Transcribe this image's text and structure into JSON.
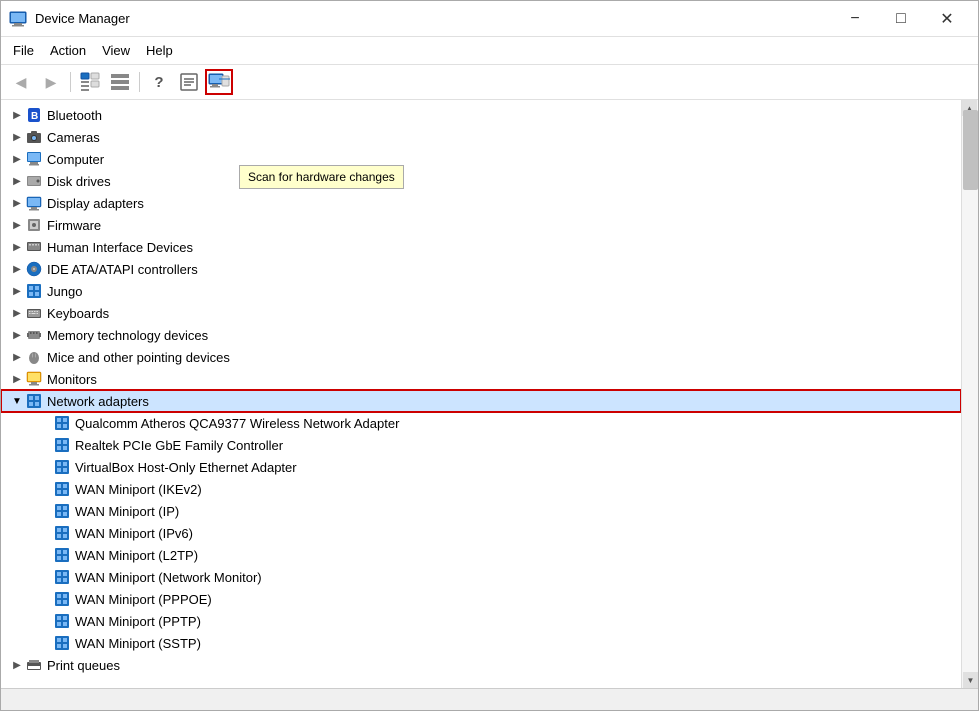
{
  "window": {
    "title": "Device Manager",
    "minimize_label": "−",
    "maximize_label": "□",
    "close_label": "✕"
  },
  "menu": {
    "items": [
      "File",
      "Action",
      "View",
      "Help"
    ]
  },
  "toolbar": {
    "buttons": [
      "back",
      "forward",
      "tree",
      "nodelist",
      "help",
      "props",
      "scan"
    ],
    "scan_tooltip": "Scan for hardware changes"
  },
  "tree": {
    "items": [
      {
        "id": "bluetooth",
        "label": "Bluetooth",
        "icon": "bluetooth",
        "expanded": false,
        "level": 0
      },
      {
        "id": "cameras",
        "label": "Cameras",
        "icon": "camera",
        "expanded": false,
        "level": 0
      },
      {
        "id": "computer",
        "label": "Computer",
        "icon": "computer",
        "expanded": false,
        "level": 0
      },
      {
        "id": "diskdrives",
        "label": "Disk drives",
        "icon": "disk",
        "expanded": false,
        "level": 0
      },
      {
        "id": "displayadapters",
        "label": "Display adapters",
        "icon": "display",
        "expanded": false,
        "level": 0
      },
      {
        "id": "firmware",
        "label": "Firmware",
        "icon": "fw",
        "expanded": false,
        "level": 0
      },
      {
        "id": "hid",
        "label": "Human Interface Devices",
        "icon": "hid",
        "expanded": false,
        "level": 0
      },
      {
        "id": "ide",
        "label": "IDE ATA/ATAPI controllers",
        "icon": "ide",
        "expanded": false,
        "level": 0
      },
      {
        "id": "jungo",
        "label": "Jungo",
        "icon": "jungo",
        "expanded": false,
        "level": 0
      },
      {
        "id": "keyboards",
        "label": "Keyboards",
        "icon": "keyboard",
        "expanded": false,
        "level": 0
      },
      {
        "id": "memtech",
        "label": "Memory technology devices",
        "icon": "mem",
        "expanded": false,
        "level": 0
      },
      {
        "id": "mice",
        "label": "Mice and other pointing devices",
        "icon": "mouse",
        "expanded": false,
        "level": 0
      },
      {
        "id": "monitors",
        "label": "Monitors",
        "icon": "monitor",
        "expanded": false,
        "level": 0
      },
      {
        "id": "networkadapters",
        "label": "Network adapters",
        "icon": "net",
        "expanded": true,
        "level": 0,
        "selected": true
      },
      {
        "id": "qualcomm",
        "label": "Qualcomm Atheros QCA9377 Wireless Network Adapter",
        "icon": "netdev",
        "level": 1
      },
      {
        "id": "realtek",
        "label": "Realtek PCIe GbE Family Controller",
        "icon": "netdev",
        "level": 1
      },
      {
        "id": "virtualbox",
        "label": "VirtualBox Host-Only Ethernet Adapter",
        "icon": "netdev",
        "level": 1
      },
      {
        "id": "wan_ikev2",
        "label": "WAN Miniport (IKEv2)",
        "icon": "netdev",
        "level": 1
      },
      {
        "id": "wan_ip",
        "label": "WAN Miniport (IP)",
        "icon": "netdev",
        "level": 1
      },
      {
        "id": "wan_ipv6",
        "label": "WAN Miniport (IPv6)",
        "icon": "netdev",
        "level": 1
      },
      {
        "id": "wan_l2tp",
        "label": "WAN Miniport (L2TP)",
        "icon": "netdev",
        "level": 1
      },
      {
        "id": "wan_netmon",
        "label": "WAN Miniport (Network Monitor)",
        "icon": "netdev",
        "level": 1
      },
      {
        "id": "wan_pppoe",
        "label": "WAN Miniport (PPPOE)",
        "icon": "netdev",
        "level": 1
      },
      {
        "id": "wan_pptp",
        "label": "WAN Miniport (PPTP)",
        "icon": "netdev",
        "level": 1
      },
      {
        "id": "wan_sstp",
        "label": "WAN Miniport (SSTP)",
        "icon": "netdev",
        "level": 1
      },
      {
        "id": "printqueues",
        "label": "Print queues",
        "icon": "print",
        "expanded": false,
        "level": 0
      }
    ]
  }
}
